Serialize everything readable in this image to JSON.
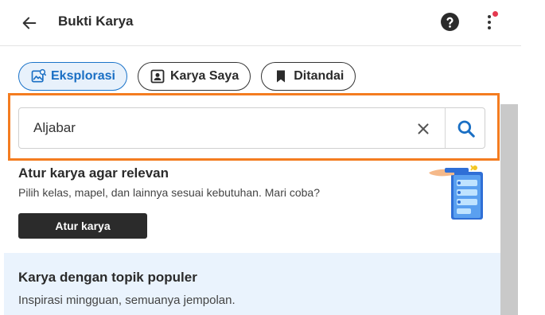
{
  "header": {
    "title": "Bukti Karya",
    "back_icon": "arrow-left-icon",
    "help_icon": "question-circle-icon",
    "more_icon": "more-vertical-icon",
    "notification_color": "#e53950"
  },
  "tabs": [
    {
      "label": "Eksplorasi",
      "icon": "gallery-icon",
      "active": true
    },
    {
      "label": "Karya Saya",
      "icon": "portrait-icon",
      "active": false
    },
    {
      "label": "Ditandai",
      "icon": "bookmark-icon",
      "active": false
    }
  ],
  "search": {
    "value": "Aljabar",
    "clear_icon": "close-icon",
    "search_icon": "search-icon",
    "highlight_color": "#f47c20"
  },
  "promo": {
    "title": "Atur karya agar relevan",
    "description": "Pilih kelas, mapel, dan lainnya sesuai kebutuhan. Mari coba?",
    "button_label": "Atur karya"
  },
  "popular": {
    "title": "Karya dengan topik populer",
    "description": "Inspirasi mingguan, semuanya jempolan."
  },
  "colors": {
    "accent": "#1a73c9",
    "accent_bg": "#e8f1fb",
    "dark": "#2b2b2b",
    "popular_bg": "#eaf3fd"
  }
}
